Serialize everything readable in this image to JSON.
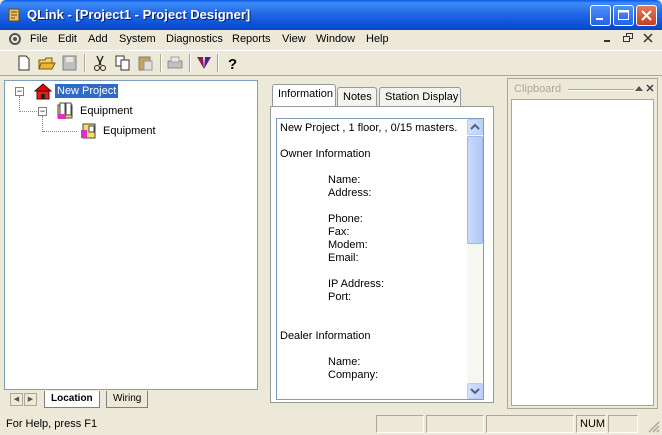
{
  "window": {
    "title": "QLink - [Project1 - Project Designer]"
  },
  "menu": {
    "items": [
      "File",
      "Edit",
      "Add",
      "System",
      "Diagnostics",
      "Reports",
      "View",
      "Window",
      "Help"
    ]
  },
  "tree": {
    "root": "New Project",
    "child": "Equipment",
    "grandchild": "Equipment",
    "tabs": [
      "Location",
      "Wiring"
    ]
  },
  "tabs": [
    "Information",
    "Notes",
    "Station Display"
  ],
  "info": {
    "summary": "New Project , 1 floor, , 0/15 masters.",
    "owner_heading": "Owner Information",
    "name": "Name:",
    "address": "Address:",
    "phone": "Phone:",
    "fax": "Fax:",
    "modem": "Modem:",
    "email": "Email:",
    "ip": "IP Address:",
    "port": "Port:",
    "dealer_heading": "Dealer Information",
    "dealer_name": "Name:",
    "dealer_company": "Company:"
  },
  "clipboard": {
    "title": "Clipboard"
  },
  "status": {
    "text": "For Help, press F1",
    "num": "NUM"
  },
  "colors": {
    "titlebar": "#0a58e8",
    "selection": "#316ac5",
    "face": "#ece9d8"
  },
  "icons": [
    "app-icon",
    "new-icon",
    "open-icon",
    "save-icon",
    "cut-icon",
    "copy-icon",
    "paste-icon",
    "print-icon",
    "logo-icon",
    "help-icon",
    "house-icon",
    "equipment-icon"
  ]
}
